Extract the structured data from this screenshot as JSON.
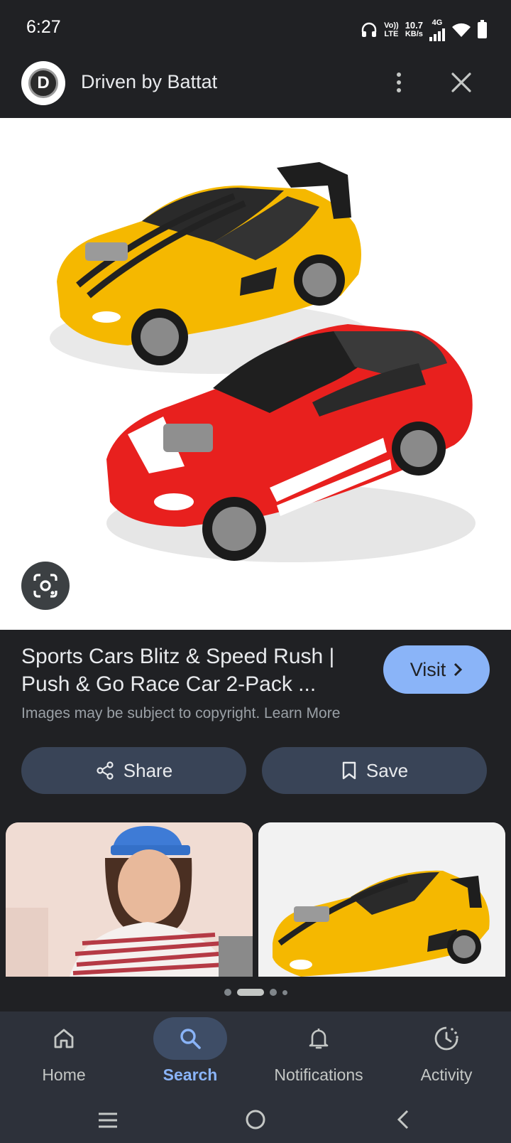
{
  "status_bar": {
    "time": "6:27",
    "volte_top": "Vo))",
    "volte_bottom": "LTE",
    "speed_value": "10.7",
    "speed_unit": "KB/s",
    "network": "4G"
  },
  "header": {
    "logo_letter": "D",
    "source_name": "Driven by Battat",
    "icons": [
      "more-vert-icon",
      "close-icon"
    ]
  },
  "image": {
    "description_icon": "google-lens-icon"
  },
  "result": {
    "title": "Sports Cars Blitz & Speed Rush | Push & Go Race Car 2-Pack ...",
    "visit_label": "Visit",
    "copyright_text": "Images may be subject to copyright. Learn More"
  },
  "actions": {
    "share_label": "Share",
    "save_label": "Save"
  },
  "pager": {
    "total_dots": 4,
    "active_index": 1
  },
  "bottom_nav": {
    "items": [
      {
        "label": "Home",
        "icon": "home-icon",
        "active": false
      },
      {
        "label": "Search",
        "icon": "search-icon",
        "active": true
      },
      {
        "label": "Notifications",
        "icon": "bell-icon",
        "active": false
      },
      {
        "label": "Activity",
        "icon": "activity-icon",
        "active": false
      }
    ]
  },
  "colors": {
    "background": "#202124",
    "accent": "#8ab4f8",
    "button_bg": "#394457",
    "nav_bg": "#2d313a"
  }
}
